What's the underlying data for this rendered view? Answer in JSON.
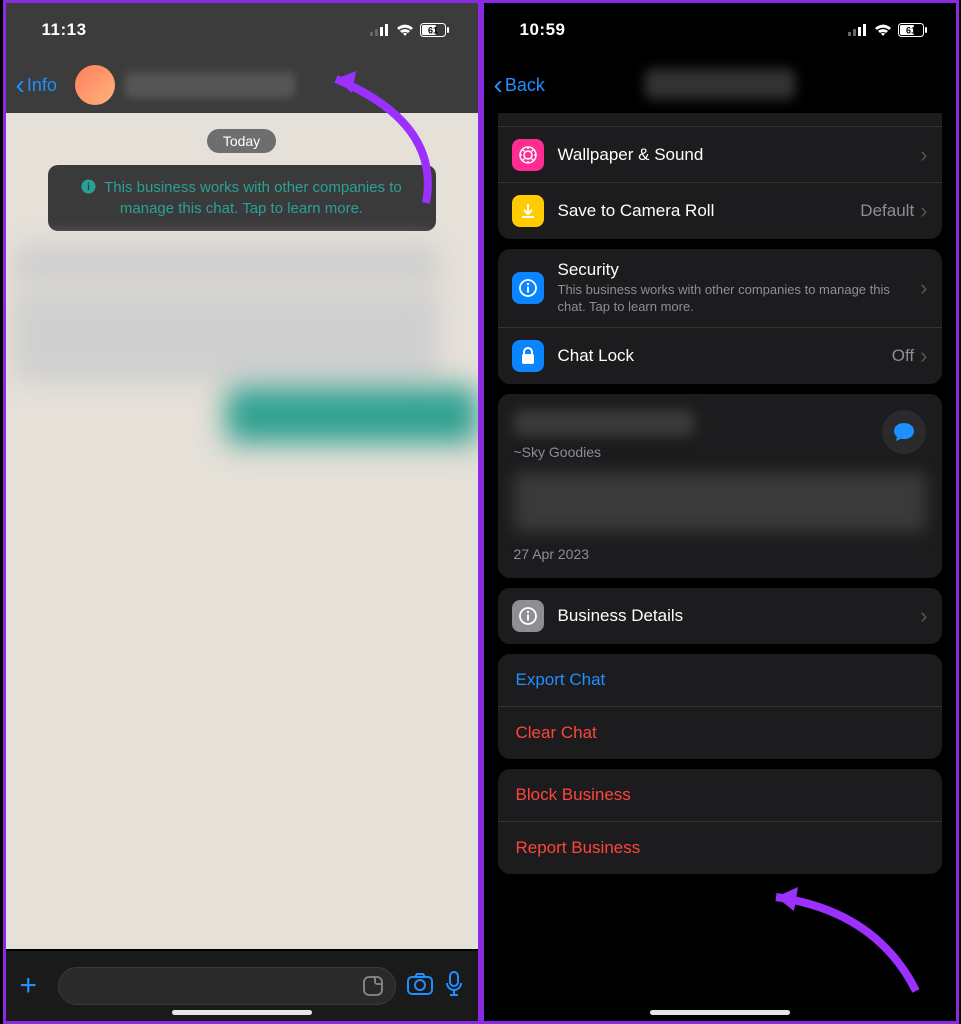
{
  "left": {
    "status_time": "11:13",
    "battery": "61",
    "back_label": "Info",
    "today_label": "Today",
    "info_text": "This business works with other companies to manage this chat. Tap to learn more."
  },
  "right": {
    "status_time": "10:59",
    "battery": "61",
    "back_label": "Back",
    "rows": {
      "wallpaper": "Wallpaper & Sound",
      "save": "Save to Camera Roll",
      "save_value": "Default",
      "security_title": "Security",
      "security_sub": "This business works with other companies to manage this chat. Tap to learn more.",
      "chatlock": "Chat Lock",
      "chatlock_value": "Off",
      "bizdetails": "Business Details",
      "export": "Export Chat",
      "clear": "Clear Chat",
      "block": "Block Business",
      "report": "Report Business"
    },
    "biz": {
      "handle": "~Sky Goodies",
      "date": "27 Apr 2023"
    }
  }
}
